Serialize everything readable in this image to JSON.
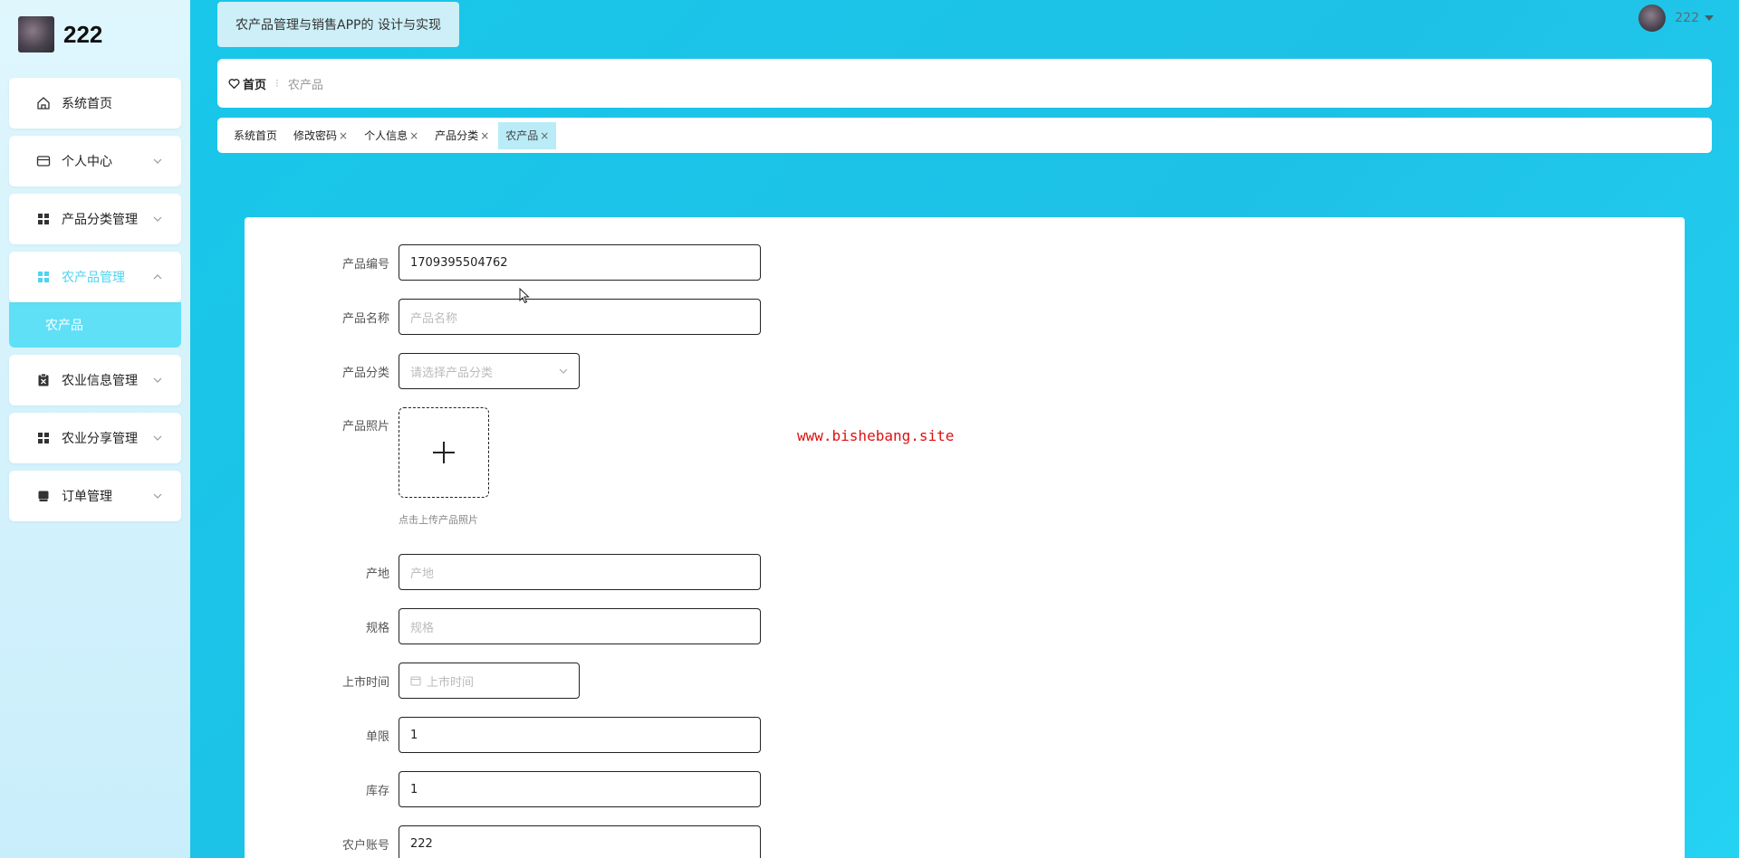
{
  "brand": {
    "name": "222"
  },
  "app": {
    "title": "农产品管理与销售APP的 设计与实现"
  },
  "user": {
    "name": "222"
  },
  "sidebar": {
    "items": [
      {
        "label": "系统首页",
        "icon": "home-icon"
      },
      {
        "label": "个人中心",
        "icon": "card-icon"
      },
      {
        "label": "产品分类管理",
        "icon": "grid-icon"
      },
      {
        "label": "农产品管理",
        "icon": "grid-icon"
      },
      {
        "label": "农业信息管理",
        "icon": "clipboard-icon"
      },
      {
        "label": "农业分享管理",
        "icon": "grid-icon"
      },
      {
        "label": "订单管理",
        "icon": "box-icon"
      }
    ],
    "active_sub": "农产品"
  },
  "breadcrumb": {
    "home": "首页",
    "current": "农产品"
  },
  "tags": [
    {
      "label": "系统首页"
    },
    {
      "label": "修改密码"
    },
    {
      "label": "个人信息"
    },
    {
      "label": "产品分类"
    },
    {
      "label": "农产品"
    }
  ],
  "form": {
    "code": {
      "label": "产品编号",
      "value": "1709395504762"
    },
    "name": {
      "label": "产品名称",
      "placeholder": "产品名称"
    },
    "category": {
      "label": "产品分类",
      "placeholder": "请选择产品分类"
    },
    "photo": {
      "label": "产品照片",
      "tip": "点击上传产品照片"
    },
    "origin": {
      "label": "产地",
      "placeholder": "产地"
    },
    "spec": {
      "label": "规格",
      "placeholder": "规格"
    },
    "date": {
      "label": "上市时间",
      "placeholder": "上市时间"
    },
    "limit": {
      "label": "单限",
      "value": "1"
    },
    "stock": {
      "label": "库存",
      "value": "1"
    },
    "farmer": {
      "label": "农户账号",
      "value": "222"
    }
  },
  "watermark": "www.bishebang.site",
  "colors": {
    "accent": "#5fe0f7",
    "active_text": "#4fd3f0",
    "watermark": "#dd1111"
  }
}
